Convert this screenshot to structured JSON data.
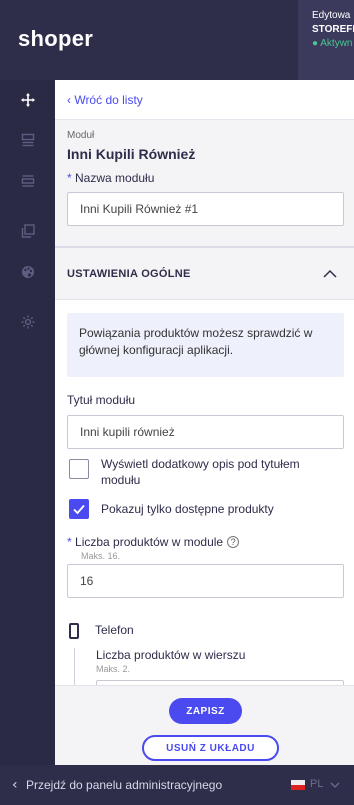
{
  "brand": {
    "logo": "shoper"
  },
  "edit_panel": {
    "line1": "Edytowa",
    "line2": "STOREFR",
    "line3": "● Aktywn"
  },
  "rail": {
    "icons": [
      "move-icon",
      "layout-icon",
      "list-icon",
      "copy-icon",
      "palette-icon",
      "settings-icon"
    ]
  },
  "nav": {
    "back_label": "‹ Wróć do listy"
  },
  "module": {
    "kicker": "Moduł",
    "name": "Inni Kupili Również",
    "name_field_label": "Nazwa modułu",
    "name_field_value": "Inni Kupili Również #1"
  },
  "general_settings": {
    "title": "USTAWIENIA OGÓLNE",
    "info": "Powiązania produktów możesz sprawdzić w głównej konfiguracji aplikacji.",
    "title_field_label": "Tytuł modułu",
    "title_field_value": "Inni kupili również",
    "show_description_label": "Wyświetl dodatkowy opis pod tytułem modułu",
    "show_description_checked": false,
    "only_available_label": "Pokazuj tylko dostępne produkty",
    "only_available_checked": true,
    "product_count_label": "Liczba produktów w module",
    "product_count_hint": "Maks. 16.",
    "product_count_value": "16",
    "device_label": "Telefon",
    "per_row_label": "Liczba produktów w wierszu",
    "per_row_hint": "Maks. 2."
  },
  "actions": {
    "save_label": "ZAPISZ",
    "remove_label": "USUŃ Z UKŁADU"
  },
  "footer": {
    "back_to_admin": "Przejdź do panelu administracyjnego",
    "language": "PL"
  },
  "colors": {
    "accent": "#4a4af0",
    "dark": "#2e2d4a",
    "active": "#4cc58f"
  }
}
